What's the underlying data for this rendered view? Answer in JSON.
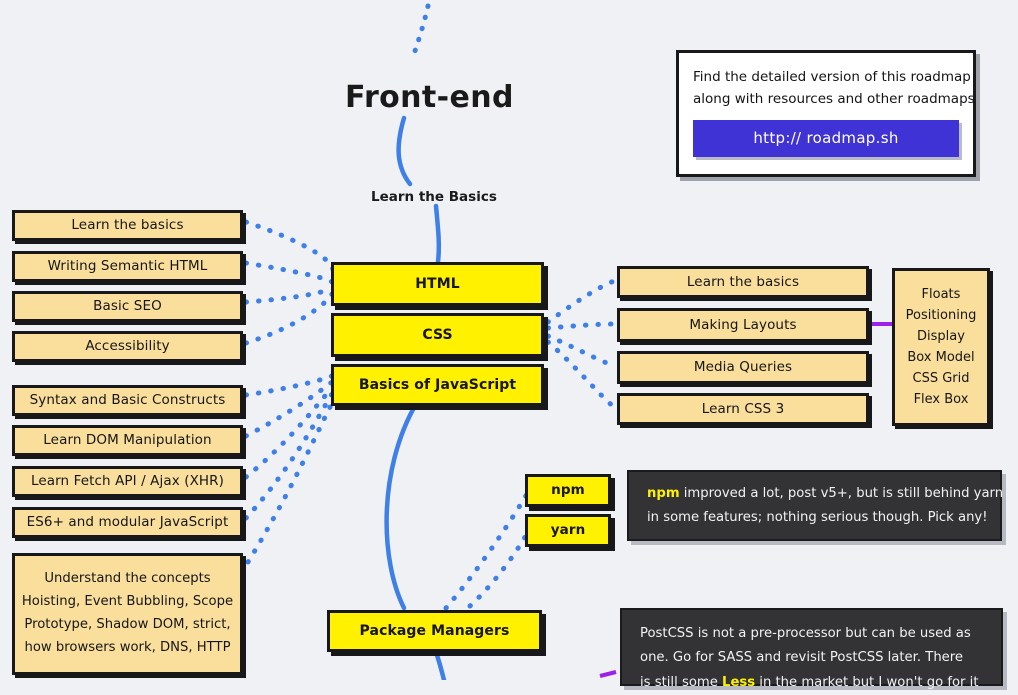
{
  "meta": {
    "title": "Front-end",
    "root_label": "Learn the Basics",
    "background": "#EFF1F5",
    "link_color": "#3F7FE8",
    "accent_purple": "#9B22E8",
    "node_yellow": "#FFF100",
    "node_peach": "#FADF9C",
    "note_dark": "#333336",
    "url_button": "#4033D6"
  },
  "info_card": {
    "line1": "Find the detailed version of this roadmap",
    "line2": "along with resources and other roadmaps",
    "url": "http:// roadmap.sh"
  },
  "center_nodes": [
    {
      "label": "HTML"
    },
    {
      "label": "CSS"
    },
    {
      "label": "Basics of JavaScript"
    },
    {
      "label": "Package Managers"
    }
  ],
  "html_topics": [
    {
      "label": "Learn the basics"
    },
    {
      "label": "Writing Semantic HTML"
    },
    {
      "label": "Basic SEO"
    },
    {
      "label": "Accessibility"
    }
  ],
  "js_topics": [
    {
      "label": "Syntax and Basic Constructs"
    },
    {
      "label": "Learn DOM Manipulation"
    },
    {
      "label": "Learn Fetch API / Ajax (XHR)"
    },
    {
      "label": "ES6+ and modular JavaScript"
    }
  ],
  "js_concepts": {
    "rows": [
      "Understand the concepts",
      "Hoisting, Event Bubbling, Scope",
      "Prototype, Shadow DOM, strict,",
      "how browsers work, DNS, HTTP"
    ]
  },
  "css_topics": [
    {
      "label": "Learn the basics"
    },
    {
      "label": "Making Layouts"
    },
    {
      "label": "Media Queries"
    },
    {
      "label": "Learn CSS 3"
    }
  ],
  "layout_topics": {
    "rows": [
      "Floats",
      "Positioning",
      "Display",
      "Box Model",
      "CSS Grid",
      "Flex Box"
    ]
  },
  "package_managers": [
    {
      "label": "npm"
    },
    {
      "label": "yarn"
    }
  ],
  "npm_note": {
    "line1_highlight": "npm",
    "line1_rest": " improved a lot, post v5+, but is still behind yarn",
    "line2": "in some features; nothing serious though. Pick any!"
  },
  "postcss_note": {
    "line1": "PostCSS is not a pre-processor but can be used as",
    "line2": "one. Go for SASS and revisit PostCSS later. There",
    "line3_pre": "is still some ",
    "line3_highlight": "Less",
    "line3_post": " in the market but I won't go for it"
  }
}
